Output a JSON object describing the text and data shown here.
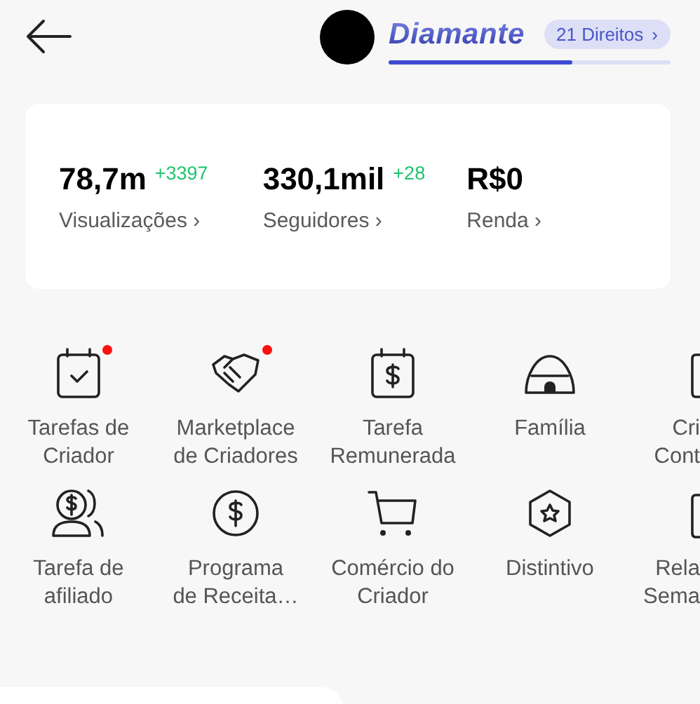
{
  "header": {
    "tier": "Diamante",
    "badge": "21 Direitos",
    "badge_arrow": "›",
    "progress": {
      "level": 0.65
    }
  },
  "stats": [
    {
      "value": "78,7m",
      "delta": "+3397",
      "label": "Visualizações",
      "arrow": "›"
    },
    {
      "value": "330,1mil",
      "delta": "+28",
      "label": "Seguidores",
      "arrow": "›"
    },
    {
      "value": "R$0",
      "label": "Renda",
      "arrow": "›"
    }
  ],
  "tools": [
    {
      "lines": [
        "Tarefas de",
        "Criador"
      ],
      "dot": true
    },
    {
      "lines": [
        "Marketplace",
        "de Criadores"
      ],
      "dot": true
    },
    {
      "lines": [
        "Tarefa",
        "Remunerada"
      ],
      "dot": false
    },
    {
      "lines": [
        "Família"
      ],
      "dot": false
    },
    {
      "lines": [
        "Cri",
        "Cont"
      ],
      "dot": false
    },
    {
      "lines": [
        "Tarefa de",
        "afiliado"
      ],
      "dot": false
    },
    {
      "lines": [
        "Programa",
        "de Receita…"
      ],
      "dot": false
    },
    {
      "lines": [
        "Comércio do",
        "Criador"
      ],
      "dot": false
    },
    {
      "lines": [
        "Distintivo"
      ],
      "dot": false
    },
    {
      "lines": [
        "Rela",
        "Sema"
      ],
      "dot": false
    }
  ]
}
